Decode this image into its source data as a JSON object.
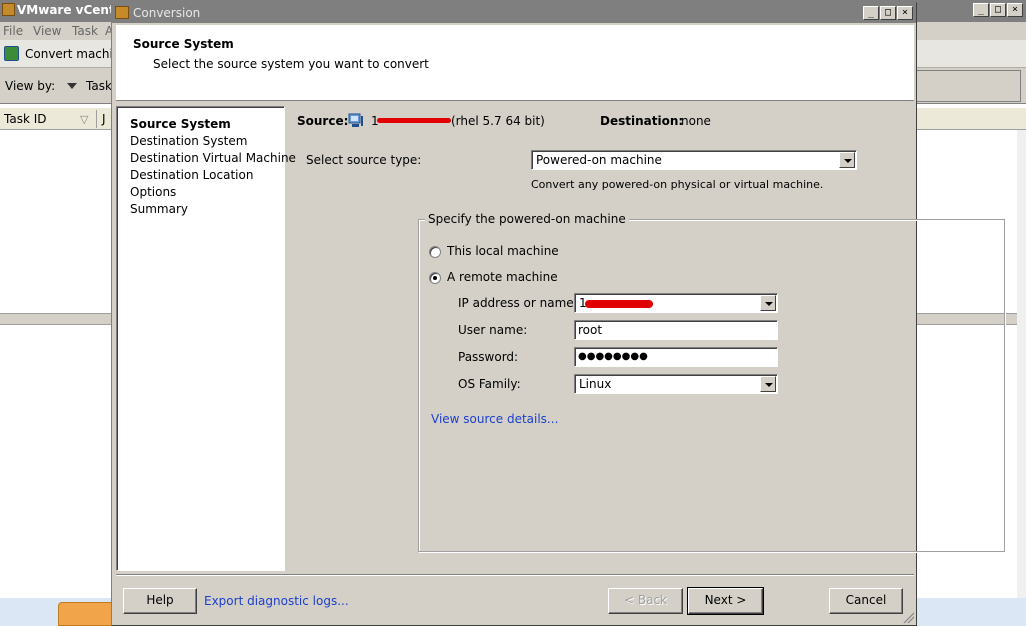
{
  "background_app": {
    "title": "VMware vCenter",
    "menu": [
      "File",
      "View",
      "Task",
      "A"
    ],
    "toolbar_convert": "Convert machine",
    "view_by_label": "View by:",
    "view_by_value": "Task",
    "grid_col_taskid": "Task ID",
    "grid_col_j": "J",
    "window_controls": [
      "_",
      "□",
      "×"
    ]
  },
  "dialog": {
    "title": "Conversion",
    "window_controls": [
      "_",
      "□",
      "×"
    ],
    "header": {
      "title": "Source System",
      "subtitle": "Select the source system you want to convert"
    },
    "nav": [
      {
        "label": "Source System",
        "active": true
      },
      {
        "label": "Destination System",
        "active": false
      },
      {
        "label": "Destination Virtual Machine",
        "active": false
      },
      {
        "label": "Destination Location",
        "active": false
      },
      {
        "label": "Options",
        "active": false
      },
      {
        "label": "Summary",
        "active": false
      }
    ],
    "source_line": {
      "source_label": "Source:",
      "source_value_suffix": "(rhel 5.7 64 bit)",
      "destination_label": "Destination:",
      "destination_value": "none"
    },
    "source_type": {
      "label": "Select source type:",
      "value": "Powered-on machine",
      "hint": "Convert any powered-on physical or virtual machine."
    },
    "group": {
      "title": "Specify the powered-on machine",
      "radio_local": "This local machine",
      "radio_remote": "A remote machine",
      "selected": "remote",
      "ip_label": "IP address or name:",
      "ip_value": "1",
      "user_label": "User name:",
      "user_value": "root",
      "password_label": "Password:",
      "password_value": "●●●●●●●●",
      "os_label": "OS Family:",
      "os_value": "Linux",
      "details_link": "View source details..."
    },
    "footer": {
      "help": "Help",
      "export_link": "Export diagnostic logs...",
      "back": "< Back",
      "next": "Next >",
      "cancel": "Cancel"
    }
  },
  "colors": {
    "dialog_bg": "#d4d0c8",
    "link": "#1a3fcc",
    "redaction": "#e00000"
  }
}
